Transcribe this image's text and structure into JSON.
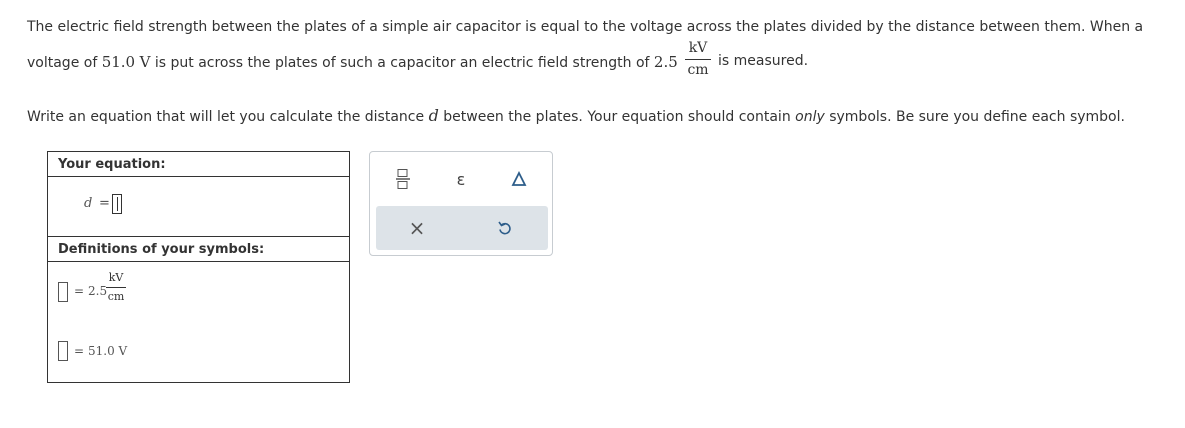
{
  "problem": {
    "line1": "The electric field strength between the plates of a simple air capacitor is equal to the voltage across the plates divided by the distance between them. When a",
    "line2_a": "voltage of ",
    "voltage_value": "51.0",
    "voltage_unit": "V",
    "line2_b": " is put across the plates of such a capacitor an electric field strength of ",
    "field_value": "2.5",
    "field_unit_num": "kV",
    "field_unit_den": "cm",
    "line2_c": "is measured.",
    "instr_a": "Write an equation that will let you calculate the distance ",
    "instr_var": "d",
    "instr_b": " between the plates. Your equation should contain ",
    "instr_only": "only",
    "instr_c": " symbols. Be sure you define each symbol."
  },
  "equation_panel": {
    "title": "Your equation:",
    "lhs_var": "d",
    "equals": "="
  },
  "definitions_panel": {
    "title": "Definitions of your symbols:",
    "def1_equals": "=",
    "def1_value": "2.5",
    "def1_unit_num": "kV",
    "def1_unit_den": "cm",
    "def2_equals": "=",
    "def2_value": "51.0 V"
  },
  "toolbar": {
    "epsilon": "ε",
    "delta": "Δ",
    "clear": "×",
    "undo": "↺"
  }
}
